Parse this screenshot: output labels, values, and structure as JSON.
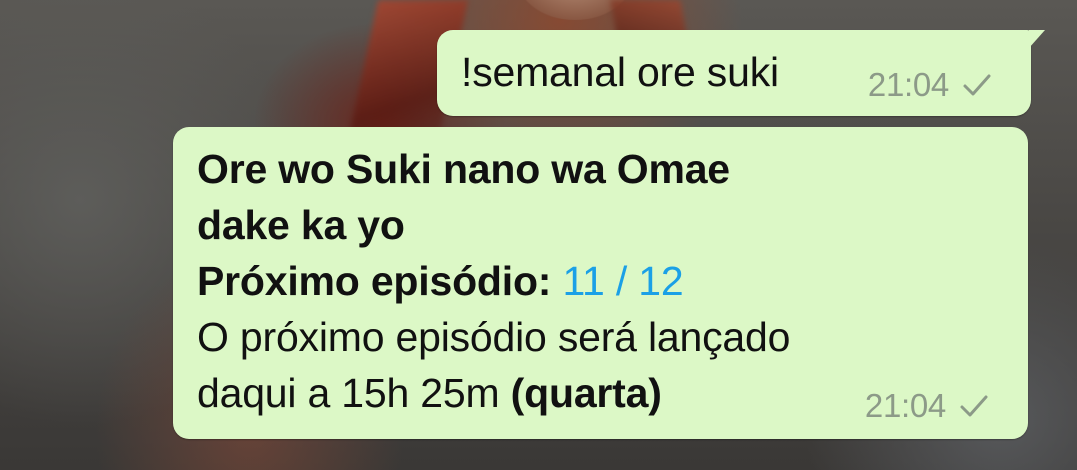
{
  "chat": {
    "messages": [
      {
        "direction": "outgoing",
        "text": "!semanal ore suki",
        "time": "21:04",
        "status_icon": "single-check-icon"
      },
      {
        "direction": "outgoing",
        "title_line1": "Ore wo Suki nano wa Omae",
        "title_line2": "dake ka yo",
        "episode_label": "Próximo episódio:",
        "episode_current": "11",
        "episode_separator": "/",
        "episode_total": "12",
        "release_line1": "O próximo episódio será lançado",
        "release_line2_prefix": "daqui a 15h 25m",
        "release_weekday": "(quarta)",
        "time": "21:04",
        "status_icon": "single-check-icon"
      }
    ]
  },
  "colors": {
    "bubble_outgoing": "#dcf8c6",
    "link": "#1ba0e6",
    "meta_text": "#8c9a88"
  }
}
